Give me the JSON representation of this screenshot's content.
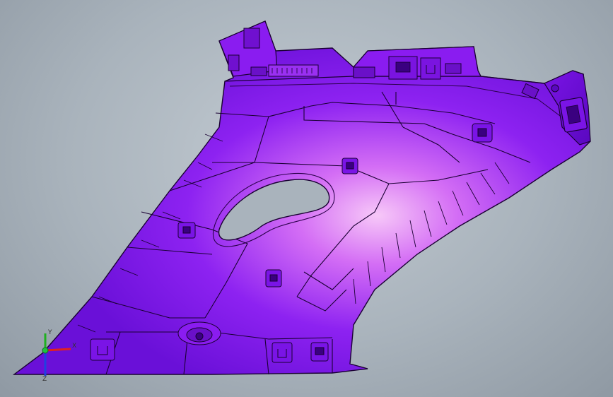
{
  "viewport": {
    "background_color": "#a9b3bc",
    "model_color": "#8a1cf0",
    "highlight_color": "#f3b8f6",
    "edge_color": "#1a0033"
  },
  "triad": {
    "x_label": "X",
    "y_label": "Y",
    "z_label": "Z",
    "x_color": "#e02020",
    "y_color": "#20b020",
    "z_color": "#2040e0"
  }
}
